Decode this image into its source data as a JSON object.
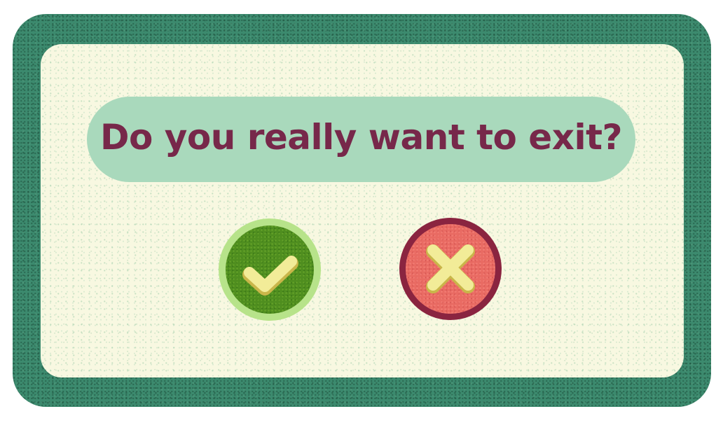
{
  "dialog": {
    "title": "Do you really want to exit?"
  },
  "buttons": {
    "confirm_icon": "checkmark-icon",
    "cancel_icon": "cross-icon"
  },
  "colors": {
    "frame": "#3c8a6e",
    "panel": "#f8f8e1",
    "title_pill": "#a9d9bc",
    "title_text": "#77284a",
    "confirm": "#4f8e1f",
    "confirm_ring": "#b7e38a",
    "cancel": "#e96b63",
    "cancel_ring": "#8a2440",
    "icon": "#f2ec98"
  }
}
